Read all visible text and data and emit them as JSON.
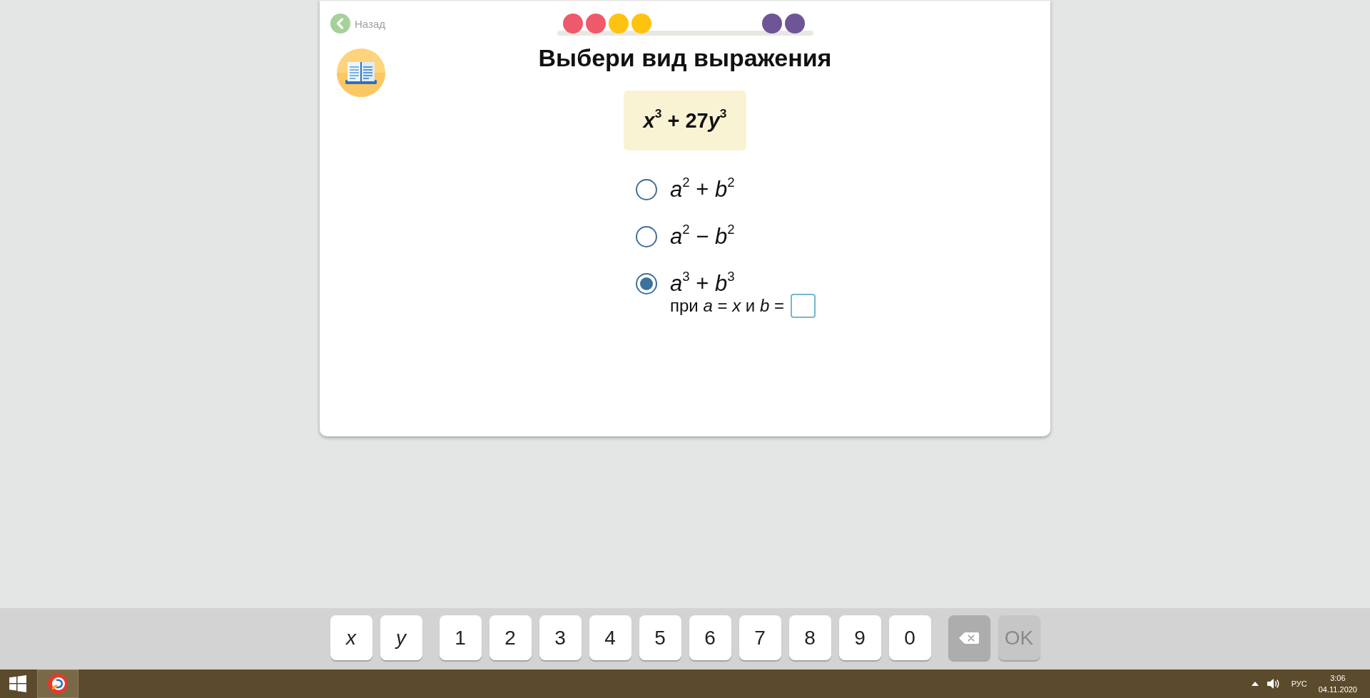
{
  "back_link": {
    "label": "Назад"
  },
  "progress": {
    "start_dots": [
      {
        "color": "#ee5a6b"
      },
      {
        "color": "#ee5a6b"
      },
      {
        "color": "#ffc30f"
      },
      {
        "color": "#ffc30f"
      }
    ],
    "end_dots": [
      {
        "color": "#6e5597"
      },
      {
        "color": "#6e5597"
      }
    ]
  },
  "title": "Выбери вид выражения",
  "expression": [
    "*x*$^{3}$ + 27",
    "*y*$^{3}$"
  ],
  "options": [
    {
      "text": "*a*$^{2}$ + *b*$^{2}$",
      "selected": false
    },
    {
      "text": "*a*$^{2}$ − *b*$^{2}$",
      "selected": false
    },
    {
      "text": "*a*$^{3}$ + *b*$^{3}$",
      "selected": true,
      "condition": "при *a* = *x* и *b* ="
    }
  ],
  "keyboard": {
    "keys": [
      {
        "kind": "variable",
        "label": "x"
      },
      {
        "kind": "variable",
        "label": "y"
      },
      {
        "kind": "digit",
        "label": "1"
      },
      {
        "kind": "digit",
        "label": "2"
      },
      {
        "kind": "digit",
        "label": "3"
      },
      {
        "kind": "digit",
        "label": "4"
      },
      {
        "kind": "digit",
        "label": "5"
      },
      {
        "kind": "digit",
        "label": "6"
      },
      {
        "kind": "digit",
        "label": "7"
      },
      {
        "kind": "digit",
        "label": "8"
      },
      {
        "kind": "digit",
        "label": "9"
      },
      {
        "kind": "digit",
        "label": "0"
      },
      {
        "kind": "backspace"
      },
      {
        "kind": "submit",
        "label": "OK",
        "disabled": true
      }
    ]
  },
  "taskbar": {
    "apps": [
      {
        "active": true
      }
    ],
    "tray": {
      "language": "РУС",
      "time": "3:06",
      "date": "04.11.2020"
    }
  }
}
